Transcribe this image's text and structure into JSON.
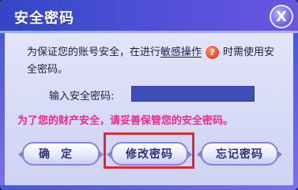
{
  "dialog": {
    "title": "安全密码",
    "close_label": "X",
    "description_part1": "为保证您的账号安全，在进行",
    "description_highlight": "敏感操作",
    "help_icon_label": "?",
    "description_part2": "时需使用安全密码。",
    "password_label": "输入安全密码:",
    "password_value": "",
    "warning": "为了您的财产安全，请妥善保管您的安全密码。",
    "buttons": {
      "confirm": "确定",
      "modify": "修改密码",
      "forgot": "忘记密码"
    }
  },
  "colors": {
    "title_bar": "#3346c4",
    "warning_text": "#ea2a8c",
    "highlight_box": "#e32636",
    "input_bg": "#3d4fb5"
  }
}
